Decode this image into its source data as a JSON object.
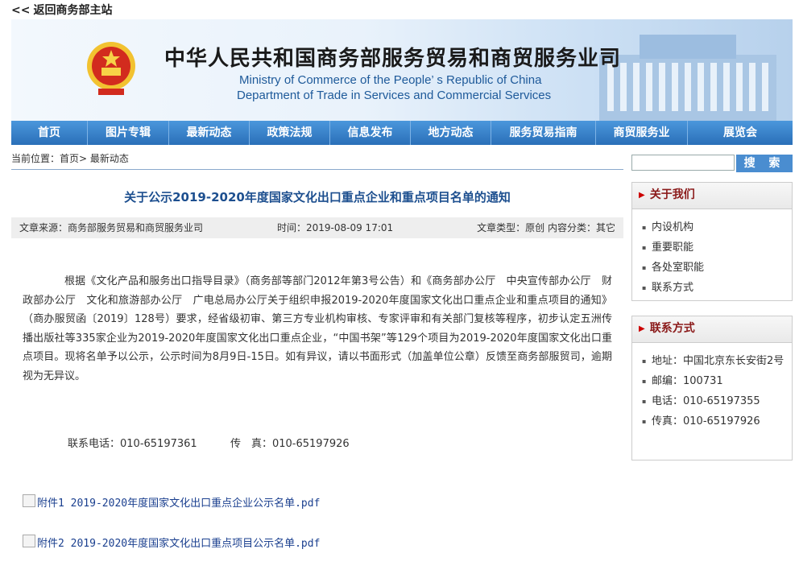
{
  "top_link": {
    "chevron": "<<",
    "label": "返回商务部主站"
  },
  "banner": {
    "title_zh": "中华人民共和国商务部服务贸易和商贸服务业司",
    "title_en_line1": "Ministry of Commerce of the People’ s Republic of China",
    "title_en_line2": "Department of Trade in Services and Commercial Services"
  },
  "nav": [
    {
      "label": "首页"
    },
    {
      "label": "图片专辑"
    },
    {
      "label": "最新动态"
    },
    {
      "label": "政策法规"
    },
    {
      "label": "信息发布"
    },
    {
      "label": "地方动态"
    },
    {
      "label": "服务贸易指南"
    },
    {
      "label": "商贸服务业"
    },
    {
      "label": "展览会"
    }
  ],
  "breadcrumb": "当前位置：首页> 最新动态",
  "search": {
    "placeholder": "",
    "button": "搜 索"
  },
  "article": {
    "title": "关于公示2019-2020年度国家文化出口重点企业和重点项目名单的通知",
    "source": "文章来源：商务部服务贸易和商贸服务业司",
    "time": "时间：2019-08-09 17:01",
    "type": "文章类型：原创 内容分类：其它",
    "body": "根据《文化产品和服务出口指导目录》（商务部等部门2012年第3号公告）和《商务部办公厅　中央宣传部办公厅　财政部办公厅　文化和旅游部办公厅　广电总局办公厅关于组织申报2019-2020年度国家文化出口重点企业和重点项目的通知》（商办服贸函〔2019〕128号）要求，经省级初审、第三方专业机构审核、专家评审和有关部门复核等程序，初步认定五洲传播出版社等335家企业为2019-2020年度国家文化出口重点企业，“中国书架”等129个项目为2019-2020年度国家文化出口重点项目。现将名单予以公示，公示时间为8月9日-15日。如有异议，请以书面形式（加盖单位公章）反馈至商务部服贸司，逾期视为无异议。",
    "contact": "联系电话：010-65197361          传　真：010-65197926",
    "attachments": [
      "附件1 2019-2020年度国家文化出口重点企业公示名单.pdf",
      "附件2 2019-2020年度国家文化出口重点项目公示名单.pdf"
    ]
  },
  "sidebar": {
    "about": {
      "title": "关于我们",
      "items": [
        "内设机构",
        "重要职能",
        "各处室职能",
        "联系方式"
      ]
    },
    "contact": {
      "title": "联系方式",
      "items": [
        "地址：中国北京东长安街2号",
        "邮编：100731",
        "电话：010-65197355",
        "传真：010-65197926"
      ]
    }
  },
  "colors": {
    "nav": "#3a82cc",
    "title": "#1d4f8f",
    "side_head": "#8b1a1a"
  }
}
